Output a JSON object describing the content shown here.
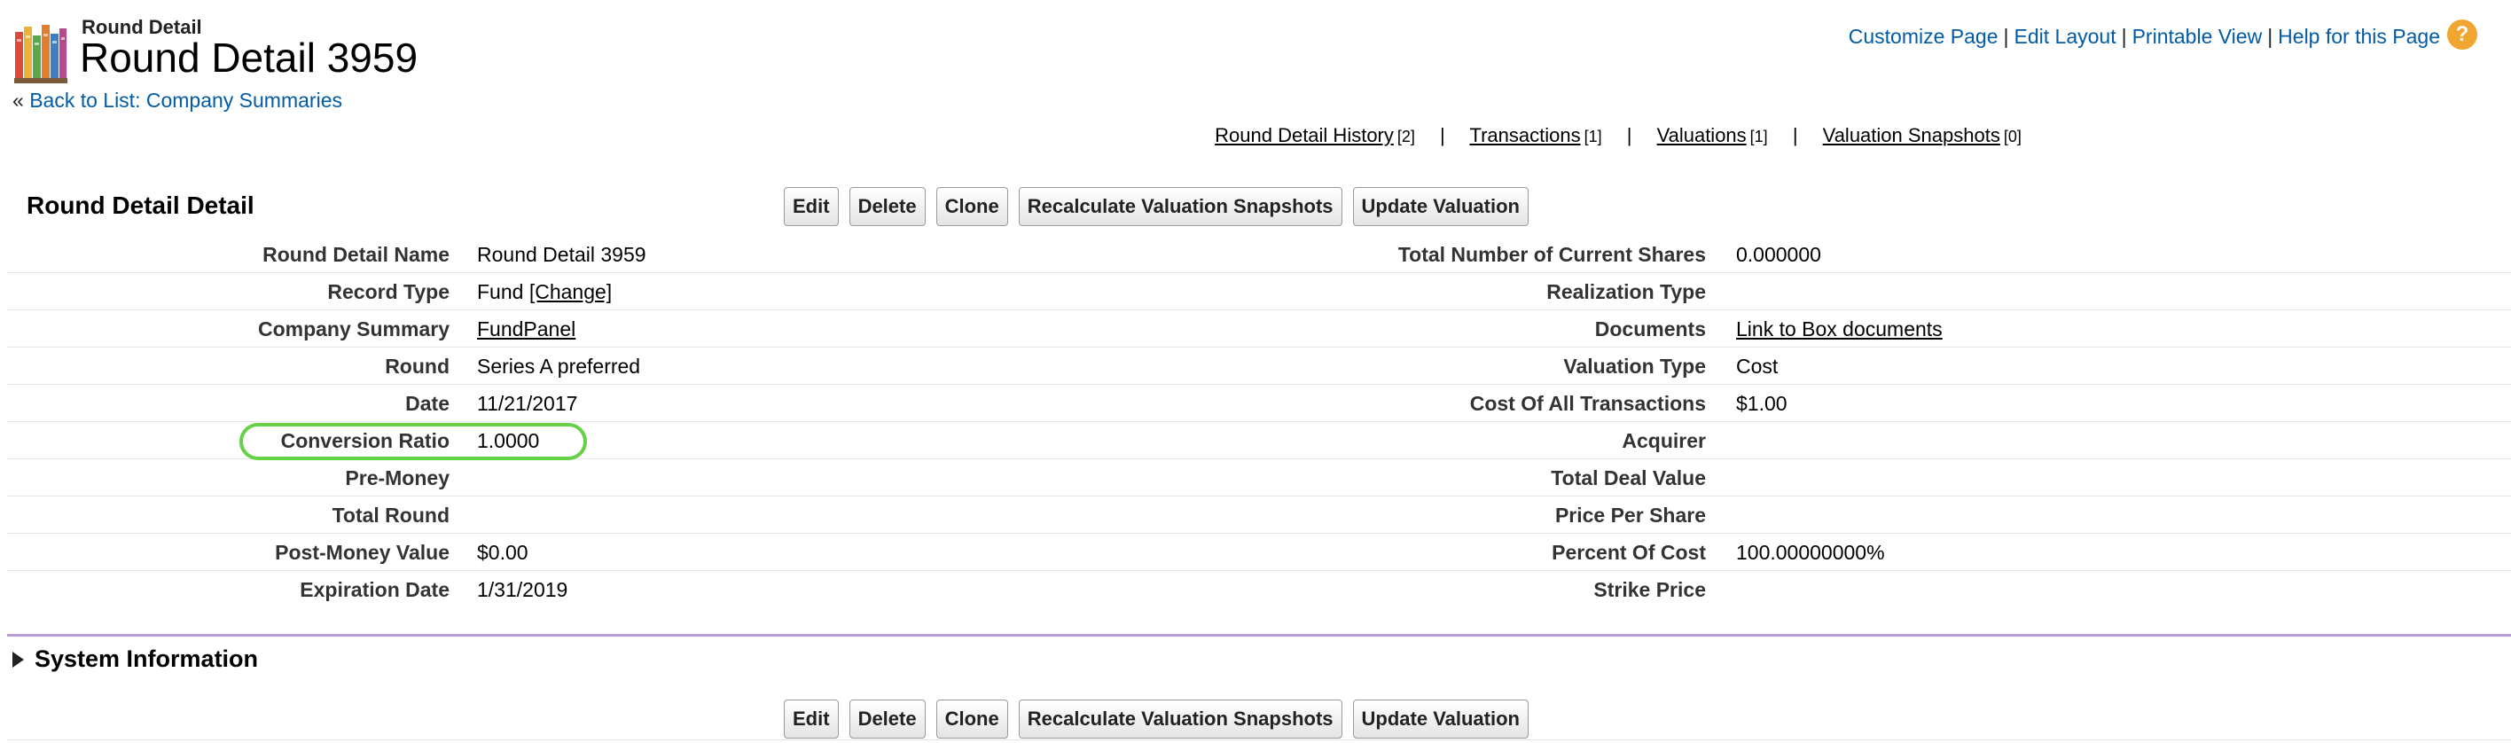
{
  "header": {
    "object_label": "Round Detail",
    "record_title": "Round Detail 3959",
    "back_prefix": "«",
    "back_link": "Back to List: Company Summaries"
  },
  "top_links": [
    "Customize Page",
    "Edit Layout",
    "Printable View",
    "Help for this Page"
  ],
  "help_icon_glyph": "?",
  "related_links": [
    {
      "label": "Round Detail History",
      "count": "[2]"
    },
    {
      "label": "Transactions",
      "count": "[1]"
    },
    {
      "label": "Valuations",
      "count": "[1]"
    },
    {
      "label": "Valuation Snapshots",
      "count": "[0]"
    }
  ],
  "related_sep": "|",
  "section": {
    "title": "Round Detail Detail",
    "buttons": [
      "Edit",
      "Delete",
      "Clone",
      "Recalculate Valuation Snapshots",
      "Update Valuation"
    ]
  },
  "fields_left": [
    {
      "label": "Round Detail Name",
      "value": "Round Detail 3959"
    },
    {
      "label": "Record Type",
      "value": "Fund",
      "link": "[Change]"
    },
    {
      "label": "Company Summary",
      "value": "",
      "link": "FundPanel"
    },
    {
      "label": "Round",
      "value": "Series A preferred"
    },
    {
      "label": "Date",
      "value": "11/21/2017"
    },
    {
      "label": "Conversion Ratio",
      "value": "1.0000"
    },
    {
      "label": "Pre-Money",
      "value": ""
    },
    {
      "label": "Total Round",
      "value": ""
    },
    {
      "label": "Post-Money Value",
      "value": "$0.00"
    },
    {
      "label": "Expiration Date",
      "value": "1/31/2019"
    }
  ],
  "fields_right": [
    {
      "label": "Total Number of Current Shares",
      "value": "0.000000"
    },
    {
      "label": "Realization Type",
      "value": ""
    },
    {
      "label": "Documents",
      "value": "",
      "link": "Link to Box documents"
    },
    {
      "label": "Valuation Type",
      "value": "Cost"
    },
    {
      "label": "Cost Of All Transactions",
      "value": "$1.00"
    },
    {
      "label": "Acquirer",
      "value": ""
    },
    {
      "label": "Total Deal Value",
      "value": ""
    },
    {
      "label": "Price Per Share",
      "value": ""
    },
    {
      "label": "Percent Of Cost",
      "value": "100.00000000%"
    },
    {
      "label": "Strike Price",
      "value": ""
    }
  ],
  "system_info": {
    "title": "System Information"
  },
  "colors": {
    "link": "#015ba7",
    "highlight": "#66d146",
    "section_rule": "#b79dd6",
    "help_icon": "#f0a630"
  }
}
